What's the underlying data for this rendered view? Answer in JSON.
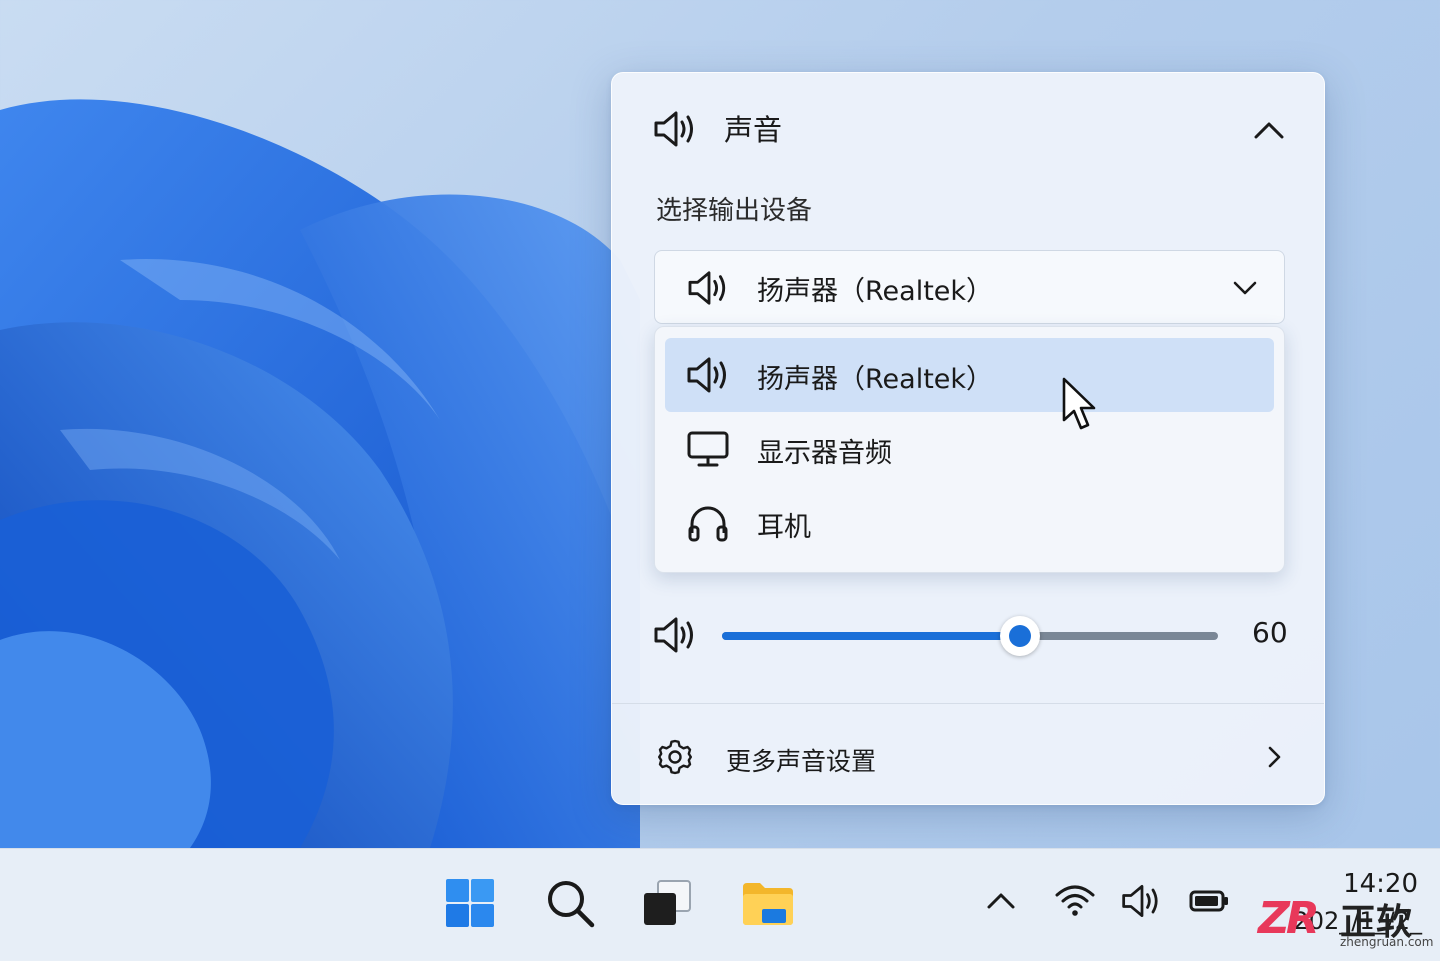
{
  "flyout": {
    "title": "声音",
    "section_label": "选择输出设备",
    "selected_device": "扬声器（Realtek）",
    "devices": [
      {
        "label": "扬声器（Realtek）",
        "icon": "speaker-icon",
        "selected": true
      },
      {
        "label": "显示器音频",
        "icon": "monitor-icon",
        "selected": false
      },
      {
        "label": "耳机",
        "icon": "headphones-icon",
        "selected": false
      }
    ],
    "volume": {
      "value": 60,
      "label": "60"
    },
    "more_settings": "更多声音设置"
  },
  "taskbar": {
    "apps": [
      "start-icon",
      "search-icon",
      "task-view-icon",
      "file-explorer-icon"
    ],
    "tray": [
      "chevron-up-icon",
      "wifi-icon",
      "speaker-icon",
      "battery-icon"
    ],
    "time": "14:20",
    "date": "202_/1_/2_"
  },
  "watermark": {
    "brand": "ZR",
    "name": "正软",
    "url": "zhengruan.com"
  },
  "colors": {
    "accent": "#1a6fd8",
    "selected_item": "#cfe0f7",
    "watermark": "#e8385a"
  }
}
